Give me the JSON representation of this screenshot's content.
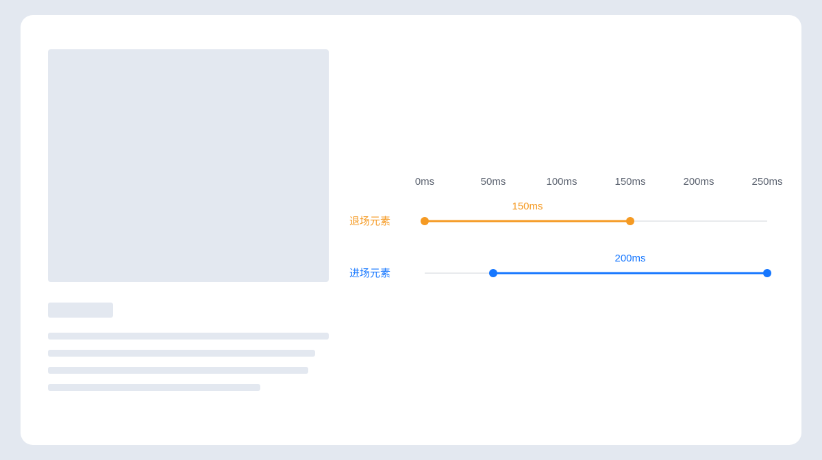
{
  "chart_data": {
    "type": "timeline",
    "axis": {
      "unit": "ms",
      "ticks": [
        0,
        50,
        100,
        150,
        200,
        250
      ]
    },
    "series": [
      {
        "name": "退场元素",
        "start": 0,
        "end": 150,
        "label": "150ms",
        "color": "#f59a23"
      },
      {
        "name": "进场元素",
        "start": 50,
        "end": 250,
        "label": "200ms",
        "color": "#1677ff"
      }
    ]
  },
  "ticks": {
    "t0": "0ms",
    "t1": "50ms",
    "t2": "100ms",
    "t3": "150ms",
    "t4": "200ms",
    "t5": "250ms"
  },
  "rows": {
    "exit": {
      "label": "退场元素",
      "duration": "150ms"
    },
    "enter": {
      "label": "进场元素",
      "duration": "200ms"
    }
  }
}
